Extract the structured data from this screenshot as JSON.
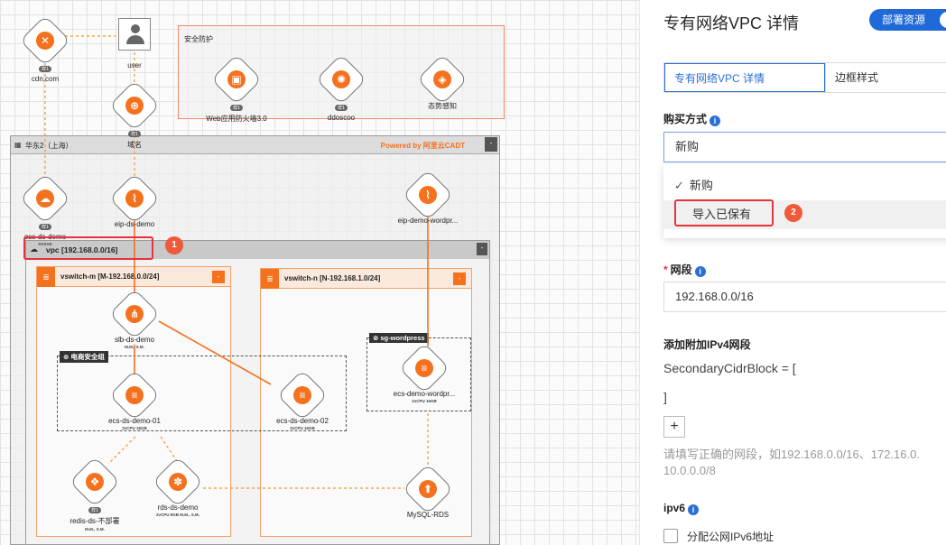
{
  "canvas": {
    "security_box_title": "安全防护",
    "region_title": "华东2（上海）",
    "powered_by": "Powered by 阿里云CADT",
    "vpc_title": "vpc [192.168.0.0/16]",
    "vswitch_m_title": "vswitch-m [M-192.168.0.0/24]",
    "vswitch_n_title": "vswitch-n [N-192.168.1.0/24]",
    "sg_ecommerce": "电商安全组",
    "sg_wordpress": "sg-wordpress",
    "minimize_glyph": "-",
    "badge1": "1",
    "badge2": "2",
    "nodes": {
      "cdn": {
        "label": "cdn.com",
        "icon": "✕",
        "tag": "样1"
      },
      "user": {
        "label": "user"
      },
      "domain": {
        "label": "域名",
        "icon": "⊕",
        "tag": "样1"
      },
      "waf": {
        "label": "Web应用防火墙3.0",
        "icon": "▣",
        "tag": "样1"
      },
      "ddos": {
        "label": "ddoscoo",
        "icon": "✺",
        "tag": "样1"
      },
      "situation": {
        "label": "态势感知",
        "icon": "◈"
      },
      "oss": {
        "label": "oss-ds-demo",
        "icon": "☁",
        "tag": "样1",
        "sub": "HA/IAE"
      },
      "eip": {
        "label": "eip-ds-demo",
        "icon": "⌇"
      },
      "eip_wp": {
        "label": "eip-demo-wordpr...",
        "icon": "⌇"
      },
      "slb": {
        "label": "slb-ds-demo",
        "icon": "⋔",
        "sub": "M.M., S.M."
      },
      "ecs1": {
        "label": "ecs-ds-demo-01",
        "icon": "≡",
        "sub": "2vCPU 16GB"
      },
      "ecs2": {
        "label": "ecs-ds-demo-02",
        "icon": "≡",
        "sub": "2vCPU 16GB"
      },
      "ecs_wp": {
        "label": "ecs-demo-wordpr...",
        "icon": "≡",
        "sub": "2vCPU 16GB"
      },
      "redis": {
        "label": "redis-ds-不部署",
        "icon": "❖",
        "tag": "样1",
        "sub": "M.M., S.M."
      },
      "rds": {
        "label": "rds-ds-demo",
        "icon": "✽",
        "sub": "2vCPU 8GB  M.M., S.M."
      },
      "mysql": {
        "label": "MySQL-RDS",
        "icon": "⬆"
      }
    }
  },
  "panel": {
    "title": "专有网络VPC 详情",
    "deploy_label": "部署资源",
    "tabs": [
      "专有网络VPC 详情",
      "边框样式"
    ],
    "buy_label": "购买方式",
    "info_glyph": "i",
    "buy_value": "新购",
    "options": [
      "新购",
      "导入已保有"
    ],
    "check_glyph": "✓",
    "cidr_required": "*",
    "cidr_label": "网段",
    "cidr_value": "192.168.0.0/16",
    "ipv4_label": "添加附加IPv4网段",
    "secondary_open": "SecondaryCidrBlock = [",
    "secondary_close": "]",
    "plus_glyph": "+",
    "hint_line1": "请填写正确的网段，如192.168.0.0/16、172.16.0.",
    "hint_line2": "10.0.0.0/8",
    "ipv6_label": "ipv6",
    "ipv6_checkbox": "分配公网IPv6地址"
  }
}
